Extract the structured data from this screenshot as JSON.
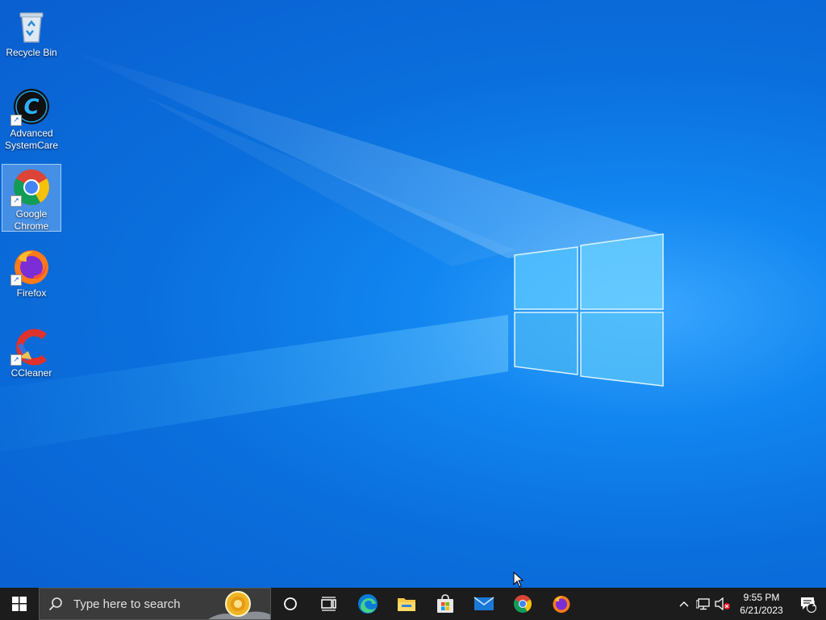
{
  "desktop": {
    "icons": [
      {
        "label": "Recycle Bin",
        "icon": "recycle-bin-icon"
      },
      {
        "label": "Advanced SystemCare",
        "icon": "advanced-systemcare-icon"
      },
      {
        "label": "Google Chrome",
        "icon": "chrome-icon"
      },
      {
        "label": "Firefox",
        "icon": "firefox-icon"
      },
      {
        "label": "CCleaner",
        "icon": "ccleaner-icon"
      }
    ]
  },
  "taskbar": {
    "search_placeholder": "Type here to search",
    "pinned": [
      {
        "name": "cortana",
        "icon": "cortana-icon"
      },
      {
        "name": "task-view",
        "icon": "task-view-icon"
      },
      {
        "name": "edge",
        "icon": "edge-icon"
      },
      {
        "name": "file-explorer",
        "icon": "folder-icon"
      },
      {
        "name": "microsoft-store",
        "icon": "store-icon"
      },
      {
        "name": "mail",
        "icon": "mail-icon"
      },
      {
        "name": "chrome",
        "icon": "chrome-icon"
      },
      {
        "name": "firefox",
        "icon": "firefox-icon"
      }
    ],
    "tray": {
      "time": "9:55 PM",
      "date": "6/21/2023",
      "notification_count": "1"
    }
  },
  "colors": {
    "taskbar_bg": "#1c1c1c",
    "desktop_accent": "#0a6fdc"
  }
}
